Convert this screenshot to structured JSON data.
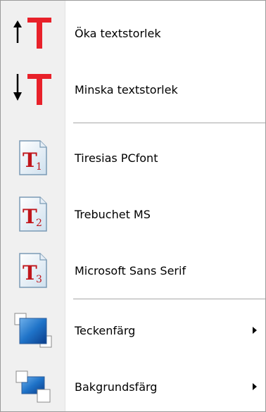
{
  "menu": {
    "items": [
      {
        "label": "Öka textstorlek",
        "icon": "increase-text-size-icon"
      },
      {
        "label": "Minska textstorlek",
        "icon": "decrease-text-size-icon"
      },
      {
        "label": "Tiresias PCfont",
        "icon": "font-1-icon",
        "index": "1"
      },
      {
        "label": "Trebuchet MS",
        "icon": "font-2-icon",
        "index": "2"
      },
      {
        "label": "Microsoft Sans Serif",
        "icon": "font-3-icon",
        "index": "3"
      },
      {
        "label": "Teckenfärg",
        "icon": "text-color-icon",
        "has_submenu": true
      },
      {
        "label": "Bakgrundsfärg",
        "icon": "background-color-icon",
        "has_submenu": true
      }
    ]
  },
  "colors": {
    "text_icon_red": "#e8212a",
    "gutter": "#f0f0f0",
    "separator": "#a8a8a8",
    "swatch_blue": "#1f73c8"
  }
}
